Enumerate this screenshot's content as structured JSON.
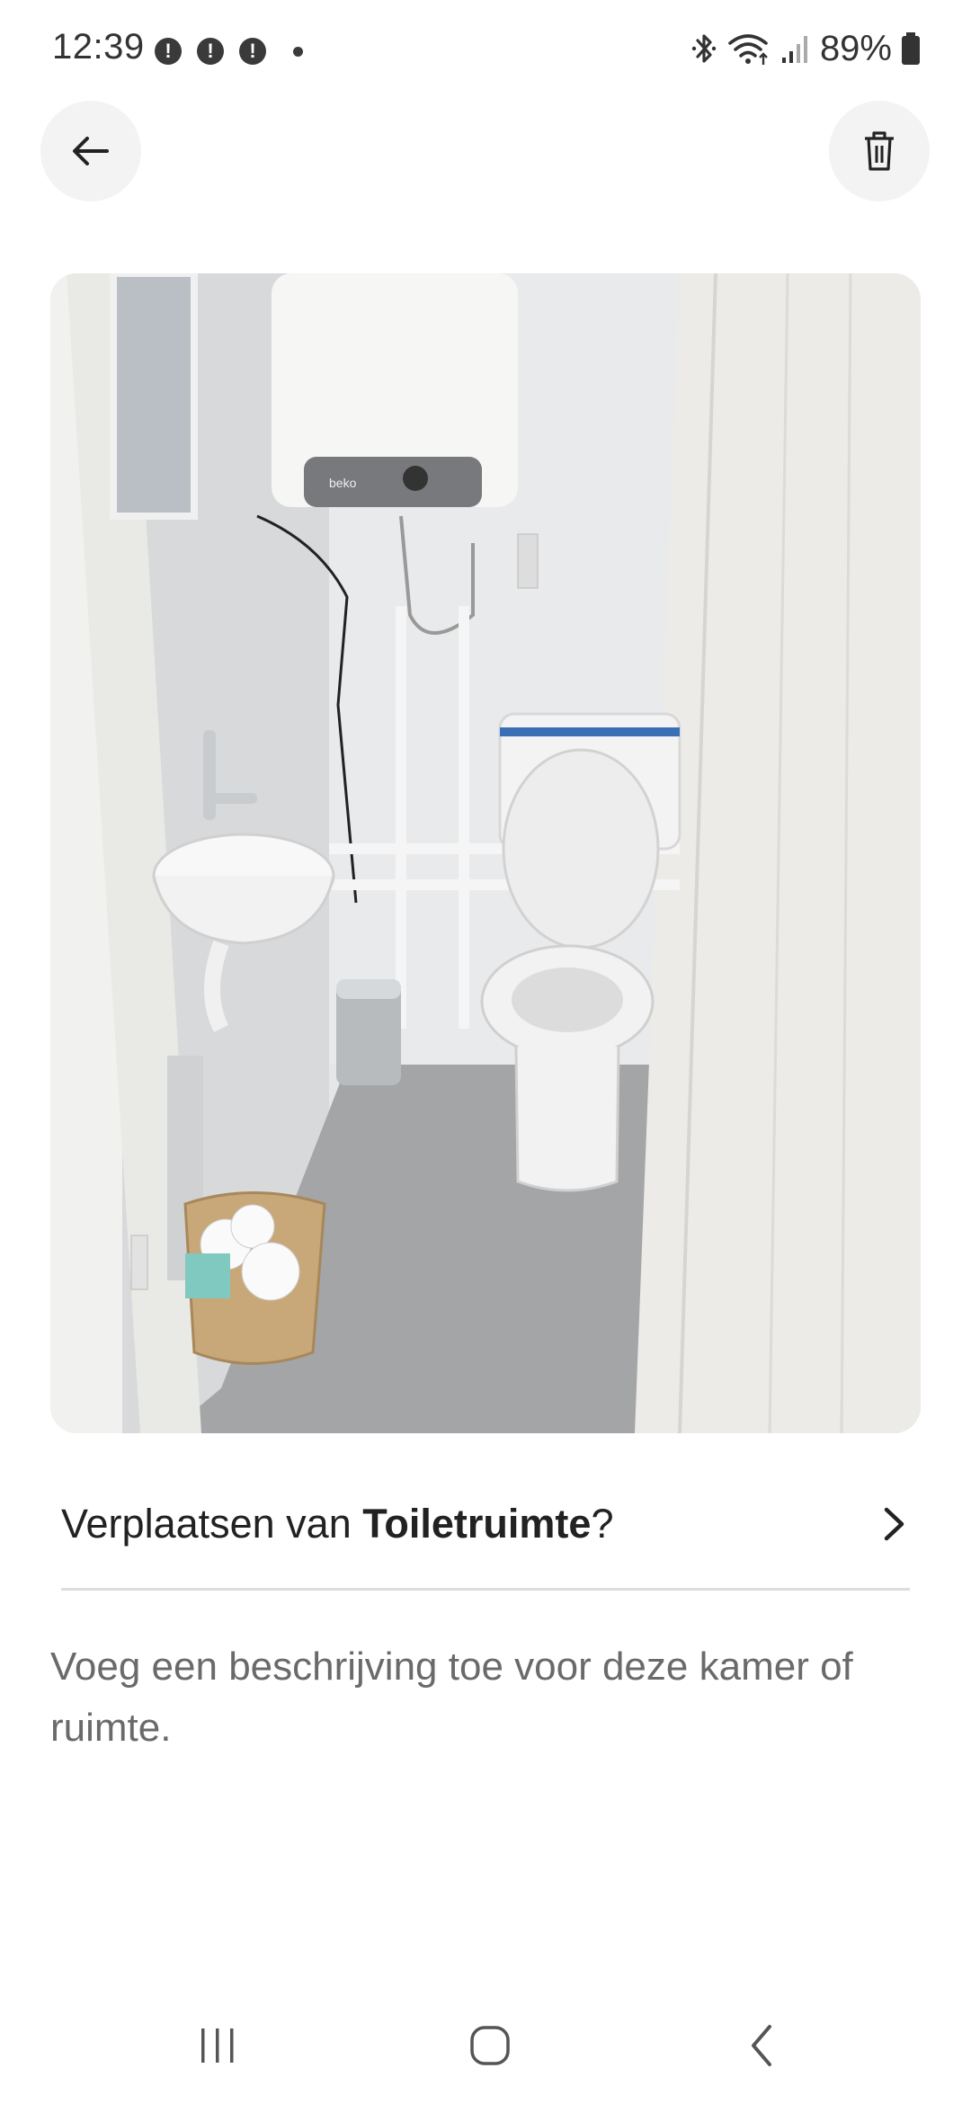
{
  "status_bar": {
    "time": "12:39",
    "notification_glyph": "!",
    "battery": "89%",
    "icons": [
      "alert-icon",
      "alert-icon",
      "alert-icon",
      "dot-icon",
      "bluetooth-icon",
      "wifi-icon",
      "signal-icon",
      "battery-icon"
    ]
  },
  "header": {
    "back_icon": "arrow-left-icon",
    "delete_icon": "trash-icon"
  },
  "photo": {
    "subject": "toilet-room-photo",
    "brand_label": "beko"
  },
  "move_row": {
    "prefix": "Verplaatsen van ",
    "room_name": "Toiletruimte",
    "suffix": "?",
    "icon": "chevron-right-icon"
  },
  "description": {
    "placeholder": "Voeg een beschrijving toe voor deze kamer of ruimte."
  },
  "nav_bar": {
    "icons": [
      "recent-apps-icon",
      "home-icon",
      "back-icon"
    ]
  },
  "colors": {
    "background": "#ffffff",
    "button_bg": "#f3f3f3",
    "text_primary": "#222222",
    "text_secondary": "#6a6a6a",
    "divider": "#dddddd"
  }
}
